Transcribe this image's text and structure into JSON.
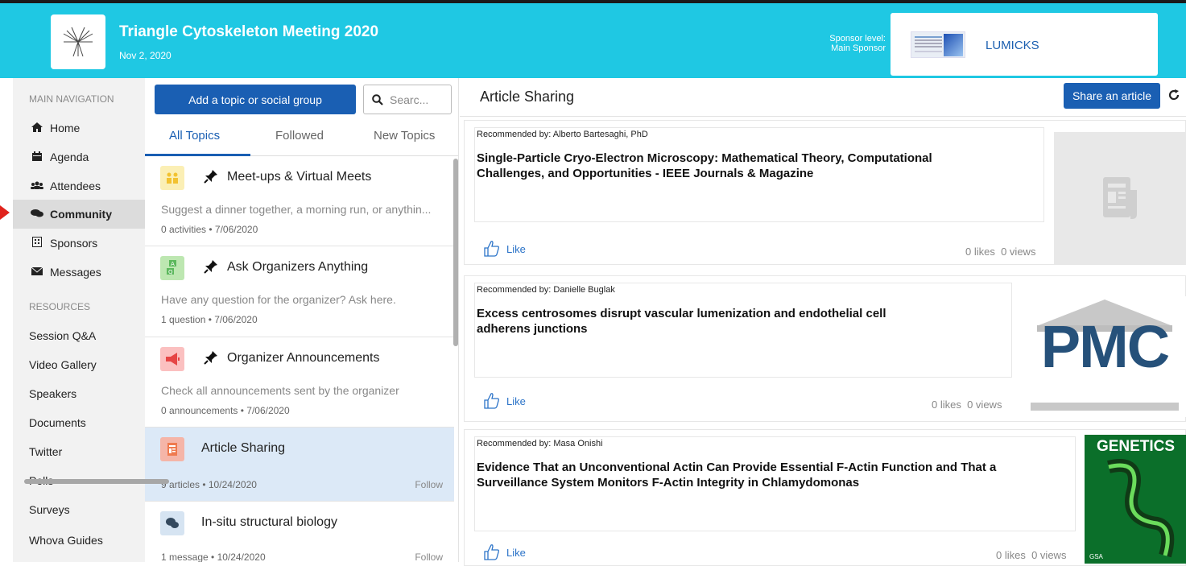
{
  "header": {
    "event_title": "Triangle Cytoskeleton Meeting 2020",
    "event_date": "Nov 2, 2020",
    "sponsor_level_label": "Sponsor level:",
    "sponsor_level_value": "Main Sponsor",
    "sponsor_name": "LUMICKS",
    "bg_color": "#1fc8e3"
  },
  "sidebar": {
    "main_nav_label": "MAIN NAVIGATION",
    "items": [
      {
        "label": "Home",
        "icon": "home-icon"
      },
      {
        "label": "Agenda",
        "icon": "calendar-icon"
      },
      {
        "label": "Attendees",
        "icon": "users-icon"
      },
      {
        "label": "Community",
        "icon": "comments-icon"
      },
      {
        "label": "Sponsors",
        "icon": "building-icon"
      },
      {
        "label": "Messages",
        "icon": "envelope-icon"
      }
    ],
    "resources_label": "RESOURCES",
    "resources": [
      "Session Q&A",
      "Video Gallery",
      "Speakers",
      "Documents",
      "Twitter",
      "Polls",
      "Surveys",
      "Whova Guides"
    ]
  },
  "topics_panel": {
    "add_button": "Add a topic or social group",
    "search_placeholder": "Searc...",
    "tabs": [
      "All Topics",
      "Followed",
      "New Topics"
    ],
    "topics": [
      {
        "title": "Meet-ups & Virtual Meets",
        "desc": "Suggest a dinner together, a morning run, or anythin...",
        "meta": "0 activities  •  7/06/2020",
        "icon": "people-icon",
        "pinned": true
      },
      {
        "title": "Ask Organizers Anything",
        "desc": "Have any question for the organizer? Ask here.",
        "meta": "1 question  •  7/06/2020",
        "icon": "qa-icon",
        "pinned": true
      },
      {
        "title": "Organizer Announcements",
        "desc": "Check all announcements sent by the organizer",
        "meta": "0 announcements  •  7/06/2020",
        "icon": "megaphone-icon",
        "pinned": true
      },
      {
        "title": "Article Sharing",
        "meta": "9 articles  •  10/24/2020",
        "follow": "Follow",
        "icon": "article-icon",
        "pinned": false
      },
      {
        "title": "In-situ structural biology",
        "meta": "1 message  •  10/24/2020",
        "follow": "Follow",
        "icon": "chat-icon",
        "pinned": false
      }
    ]
  },
  "content": {
    "title": "Article Sharing",
    "share_button": "Share an article",
    "articles": [
      {
        "recommended_by": "Recommended by: Alberto Bartesaghi, PhD",
        "title": "Single-Particle Cryo-Electron Microscopy: Mathematical Theory, Computational Challenges, and Opportunities - IEEE Journals & Magazine",
        "like": "Like",
        "likes": "0 likes",
        "views": "0 views",
        "thumb": "article-placeholder"
      },
      {
        "recommended_by": "Recommended by: Danielle Buglak",
        "title": "Excess centrosomes disrupt vascular lumenization and endothelial cell adherens junctions",
        "like": "Like",
        "likes": "0 likes",
        "views": "0 views",
        "thumb": "pmc-logo",
        "thumb_text": "PMC"
      },
      {
        "recommended_by": "Recommended by: Masa Onishi",
        "title": "Evidence That an Unconventional Actin Can Provide Essential F-Actin Function and That a Surveillance System Monitors F-Actin Integrity in Chlamydomonas",
        "like": "Like",
        "likes": "0 likes",
        "views": "0 views",
        "thumb": "genetics-cover",
        "thumb_text": "GENETICS",
        "thumb_footer": "GSA"
      }
    ]
  }
}
